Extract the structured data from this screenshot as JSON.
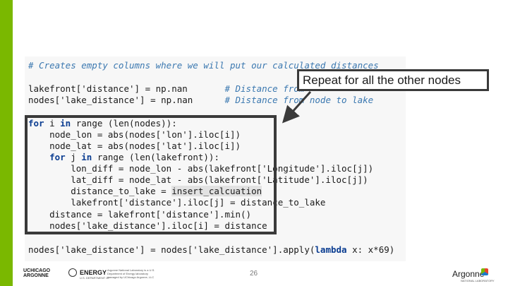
{
  "code": {
    "comment_line": "# Creates empty columns where we will put our calculated distances",
    "line2_code": "lakefront['distance'] = np.nan       ",
    "line2_comment": "# Distance from",
    "line3_code": "nodes['lake_distance'] = np.nan      ",
    "line3_comment": "# Distance from node to lake",
    "loop_lines": {
      "l1": "(len(nodes)):",
      "l2": "    node_lon = abs(nodes['lon'].iloc[i])",
      "l3": "    node_lat = abs(nodes['lat'].iloc[i])",
      "l4": "(len(lakefront)):",
      "l5": "        lon_diff = node_lon - abs(lakefront['Longitude'].iloc[j])",
      "l6": "        lat_diff = node_lat - abs(lakefront['Latitude'].iloc[j])",
      "l7a": "        distance_to_lake = ",
      "l7b": "insert_calcuation",
      "l8": "        lakefront['distance'].iloc[j] = distance_to_lake",
      "l9": "    distance = lakefront['distance'].min()",
      "l10": "    nodes['lake_distance'].iloc[i] = distance"
    },
    "keywords": {
      "for": "for",
      "in": "in",
      "range": "range",
      "lambda": "lambda",
      "indent_for": "    "
    },
    "vars": {
      "i": " i ",
      "j": " j "
    },
    "final_line_a": "nodes['lake_distance'] = nodes['lake_distance'].apply(",
    "final_line_b": " x: x*69)"
  },
  "callout": {
    "text": "Repeat for all the other nodes"
  },
  "footer": {
    "chicago": "UCHICAGO",
    "chicago2": "ARGONNE",
    "energy": "ENERGY",
    "energy_sub": "U.S. DEPARTMENT OF",
    "argonne_note": "Argonne National Laboratory is a U.S. Department of Energy laboratory managed by UChicago Argonne, LLC",
    "page_number": "26",
    "argonne": "Argonne",
    "argonne_sub": "NATIONAL LABORATORY"
  },
  "colors": {
    "accent_bar": "#7ab800",
    "comment": "#3b78b0",
    "keyword": "#0b3d91",
    "string": "#a31515"
  }
}
